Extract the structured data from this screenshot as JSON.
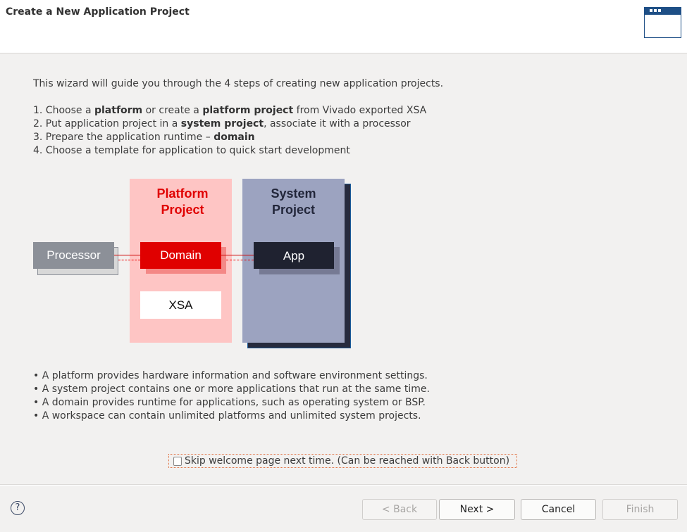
{
  "header": {
    "title": "Create a New Application Project",
    "icon": "window-icon"
  },
  "intro": "This wizard will guide you through the 4 steps of creating new application projects.",
  "steps": [
    {
      "a": "1.  Choose a ",
      "b": "platform",
      "c": " or create a ",
      "d": "platform project",
      "e": " from Vivado exported XSA"
    },
    {
      "a": "2.  Put application project in a ",
      "b": "system project",
      "c": ", associate it with a processor"
    },
    {
      "a": "3.  Prepare the application runtime – ",
      "b": "domain"
    },
    {
      "a": "4.  Choose a template for application to quick start development"
    }
  ],
  "diagram": {
    "platform_title_1": "Platform",
    "platform_title_2": "Project",
    "system_title_1": "System",
    "system_title_2": "Project",
    "processor": "Processor",
    "domain": "Domain",
    "xsa": "XSA",
    "app": "App",
    "colors": {
      "platform_bg": "#fec5c4",
      "domain": "#e00000",
      "system_bg": "#9ca3c0",
      "app": "#1f2230",
      "processor": "#8c9098"
    }
  },
  "bullets": [
    "• A platform provides hardware information and software environment settings.",
    "• A system project contains one or more applications that run at the same time.",
    "• A domain provides runtime for applications, such as operating system or BSP.",
    "• A workspace can contain unlimited platforms and unlimited system projects."
  ],
  "skip_checkbox": {
    "label": "Skip welcome page next time. (Can be reached with Back button)",
    "checked": false
  },
  "footer": {
    "help": "?",
    "back": "< Back",
    "next": "Next >",
    "cancel": "Cancel",
    "finish": "Finish"
  }
}
